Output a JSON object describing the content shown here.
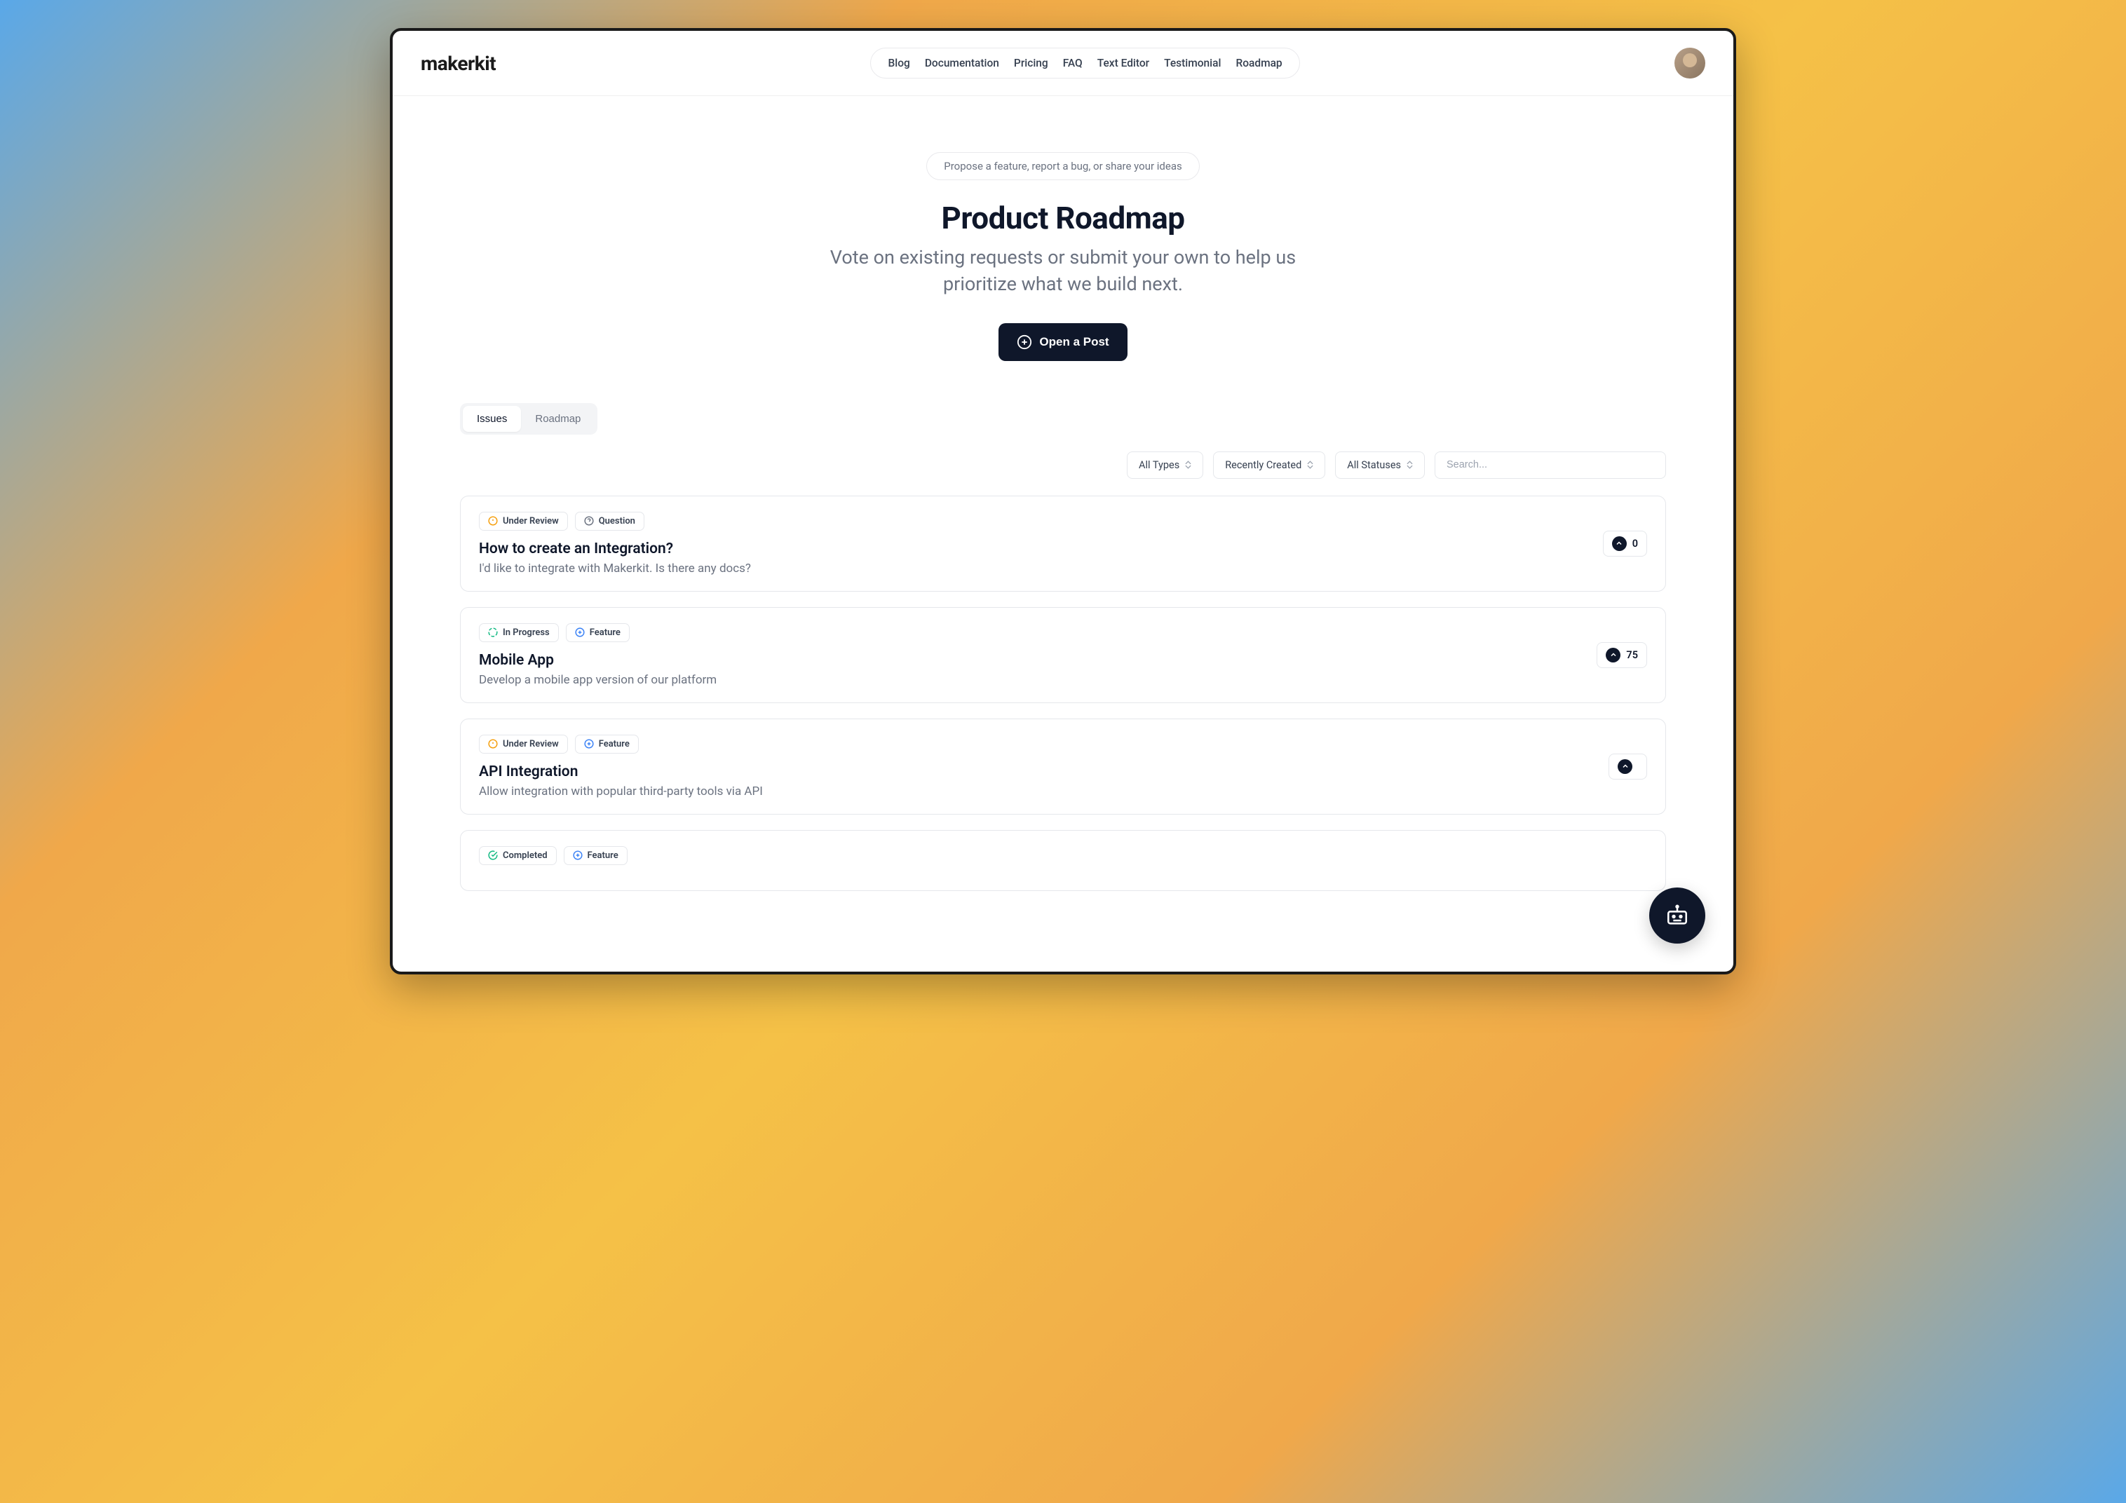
{
  "brand": "makerkit",
  "nav": {
    "items": [
      "Blog",
      "Documentation",
      "Pricing",
      "FAQ",
      "Text Editor",
      "Testimonial",
      "Roadmap"
    ]
  },
  "hero": {
    "pill": "Propose a feature, report a bug, or share your ideas",
    "title": "Product Roadmap",
    "subtitle": "Vote on existing requests or submit your own to help us prioritize what we build next.",
    "cta": "Open a Post"
  },
  "tabs": {
    "items": [
      {
        "label": "Issues",
        "active": true
      },
      {
        "label": "Roadmap",
        "active": false
      }
    ]
  },
  "filters": {
    "type": "All Types",
    "sort": "Recently Created",
    "status": "All Statuses",
    "search_placeholder": "Search..."
  },
  "cards": [
    {
      "status": {
        "label": "Under Review",
        "color": "#f59e0b"
      },
      "type": {
        "label": "Question",
        "color": "#6b7280"
      },
      "title": "How to create an Integration?",
      "desc": "I'd like to integrate with Makerkit. Is there any docs?",
      "votes": 0
    },
    {
      "status": {
        "label": "In Progress",
        "color": "#10b981"
      },
      "type": {
        "label": "Feature",
        "color": "#3b82f6"
      },
      "title": "Mobile App",
      "desc": "Develop a mobile app version of our platform",
      "votes": 75
    },
    {
      "status": {
        "label": "Under Review",
        "color": "#f59e0b"
      },
      "type": {
        "label": "Feature",
        "color": "#3b82f6"
      },
      "title": "API Integration",
      "desc": "Allow integration with popular third-party tools via API",
      "votes": ""
    },
    {
      "status": {
        "label": "Completed",
        "color": "#10b981"
      },
      "type": {
        "label": "Feature",
        "color": "#3b82f6"
      },
      "title": "",
      "desc": "",
      "votes": ""
    }
  ]
}
